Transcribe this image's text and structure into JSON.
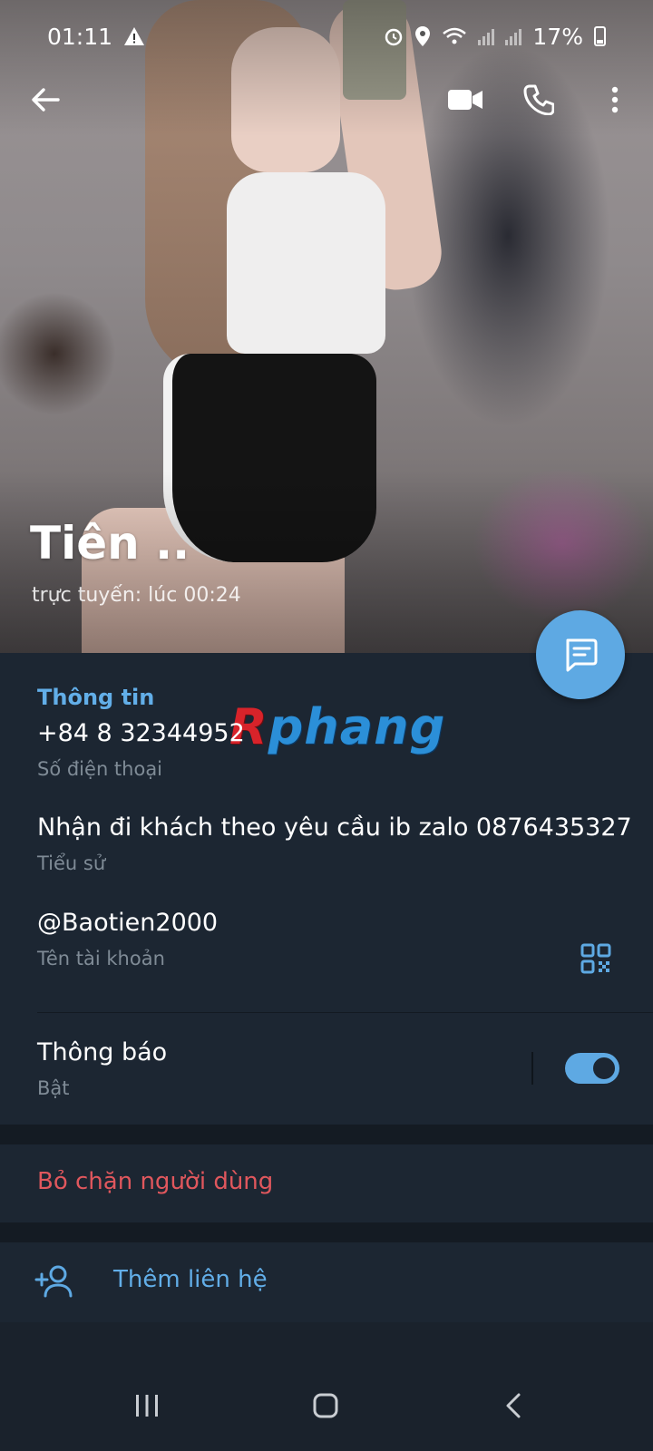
{
  "status_bar": {
    "time": "01:11",
    "battery": "17%"
  },
  "profile": {
    "name": "Tiên ..",
    "last_seen": "trực tuyến: lúc 00:24"
  },
  "info": {
    "section_title": "Thông tin",
    "phone": "+84 8 32344952",
    "phone_label": "Số điện thoại",
    "bio": "Nhận đi khách theo yêu cầu ib zalo 0876435327",
    "bio_label": "Tiểu sử",
    "username": "@Baotien2000",
    "username_label": "Tên tài khoản",
    "notifications": "Thông báo",
    "notifications_state": "Bật",
    "notifications_on": true
  },
  "watermark": {
    "first_letter": "R",
    "rest": "phang"
  },
  "actions": {
    "unblock": "Bỏ chặn người dùng",
    "add_contact": "Thêm liên hệ"
  },
  "colors": {
    "accent": "#5ea9e3",
    "danger": "#e0575d",
    "background": "#1c2632"
  },
  "icons": {
    "back": "arrow-left-icon",
    "video_call": "video-camera-icon",
    "call": "phone-icon",
    "more": "more-vertical-icon",
    "message": "message-icon",
    "qr": "qr-code-icon",
    "add_contact": "add-user-icon"
  }
}
